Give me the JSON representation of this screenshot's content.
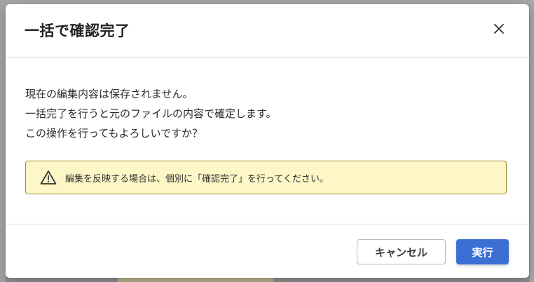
{
  "dialog": {
    "title": "一括で確認完了",
    "close_icon": "close-icon",
    "message_lines": [
      "現在の編集内容は保存されません。",
      "一括完了を行うと元のファイルの内容で確定します。",
      "この操作を行ってもよろしいですか？"
    ],
    "warning": {
      "icon": "warning-triangle-icon",
      "text": "編集を反映する場合は、個別に「確認完了」を行ってください。"
    },
    "buttons": {
      "cancel_label": "キャンセル",
      "execute_label": "実行"
    }
  },
  "colors": {
    "accent": "#3b6fd4",
    "warning_bg": "#fdf6c6",
    "warning_border": "#9f8b2f",
    "overlay": "#8f8f8f"
  }
}
